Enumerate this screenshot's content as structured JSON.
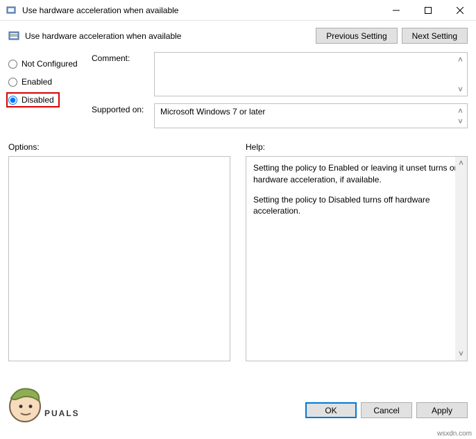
{
  "window": {
    "title": "Use hardware acceleration when available"
  },
  "header": {
    "title": "Use hardware acceleration when available",
    "prev_label": "Previous Setting",
    "next_label": "Next Setting"
  },
  "radios": {
    "not_configured": "Not Configured",
    "enabled": "Enabled",
    "disabled": "Disabled",
    "selected": "disabled"
  },
  "fields": {
    "comment_label": "Comment:",
    "comment_value": "",
    "supported_label": "Supported on:",
    "supported_value": "Microsoft Windows 7 or later"
  },
  "panels": {
    "options_label": "Options:",
    "help_label": "Help:",
    "help_text": {
      "p1": "Setting the policy to Enabled or leaving it unset turns on hardware acceleration, if available.",
      "p2": "Setting the policy to Disabled turns off hardware acceleration."
    }
  },
  "buttons": {
    "ok": "OK",
    "cancel": "Cancel",
    "apply": "Apply"
  },
  "watermark": {
    "brand": "PUALS",
    "site": "wsxdn.com"
  }
}
